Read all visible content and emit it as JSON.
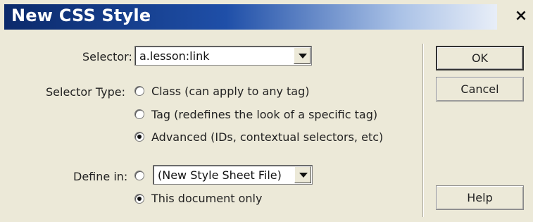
{
  "dialog": {
    "title": "New CSS Style",
    "close_glyph": "×"
  },
  "selector": {
    "label": "Selector:",
    "value": "a.lesson:link"
  },
  "selector_type": {
    "label": "Selector Type:",
    "options": [
      {
        "label": "Class (can apply to any tag)",
        "checked": false
      },
      {
        "label": "Tag (redefines the look of a specific tag)",
        "checked": false
      },
      {
        "label": "Advanced (IDs, contextual selectors, etc)",
        "checked": true
      }
    ]
  },
  "define_in": {
    "label": "Define in:",
    "file_option_checked": false,
    "file_value": "(New Style Sheet File)",
    "document_option": {
      "label": "This document only",
      "checked": true
    }
  },
  "buttons": {
    "ok": "OK",
    "cancel": "Cancel",
    "help": "Help"
  }
}
